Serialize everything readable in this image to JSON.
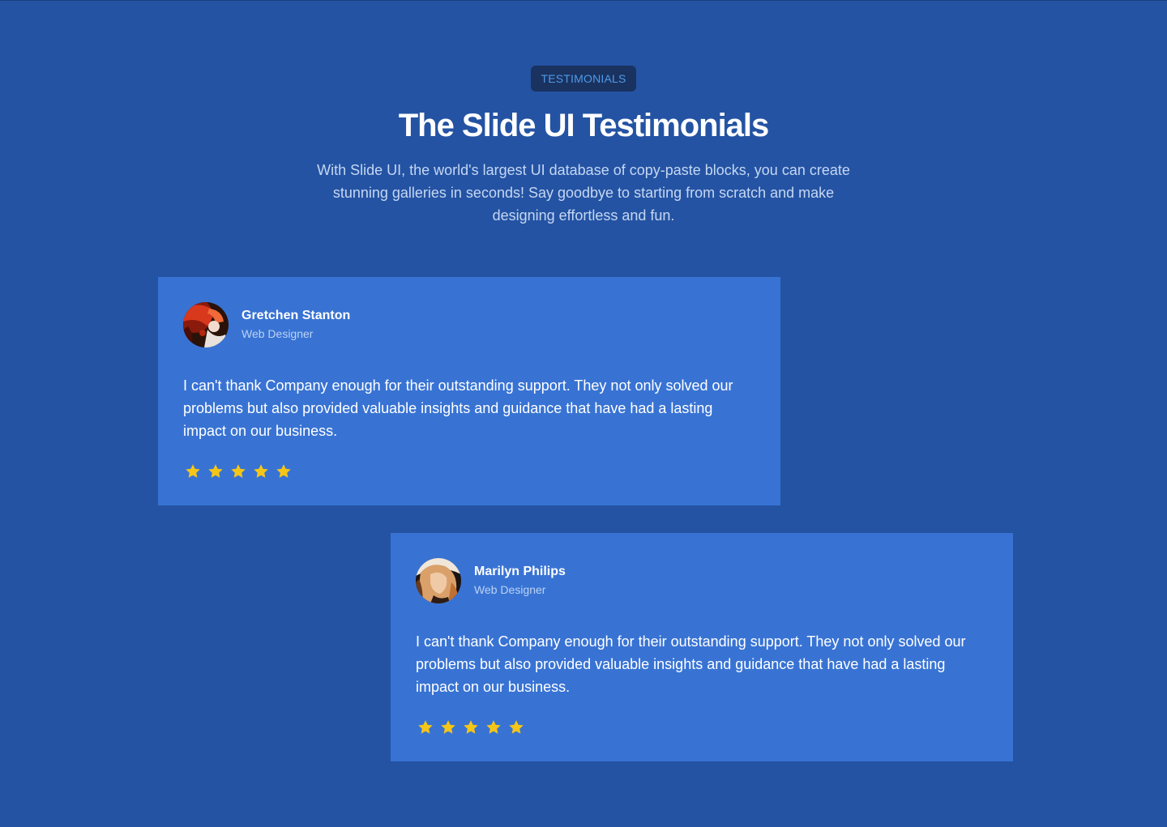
{
  "section": {
    "badge": "TESTIMONIALS",
    "title": "The Slide UI Testimonials",
    "subtitle": "With Slide UI, the world's largest UI database of copy-paste blocks, you can create stunning galleries in seconds! Say goodbye to starting from scratch and make designing effortless and fun."
  },
  "testimonials": [
    {
      "name": "Gretchen Stanton",
      "role": "Web Designer",
      "quote": "I can't thank Company enough for their outstanding support. They not only solved our problems but also provided valuable insights and guidance that have had a lasting impact on our business.",
      "rating": 5,
      "avatar_icon": "avatar-photo"
    },
    {
      "name": "Marilyn Philips",
      "role": "Web Designer",
      "quote": "I can't thank Company enough for their outstanding support. They not only solved our problems but also provided valuable insights and guidance that have had a lasting impact on our business.",
      "rating": 5,
      "avatar_icon": "avatar-photo"
    }
  ],
  "colors": {
    "background": "#2453a3",
    "card": "#3873d4",
    "badge_bg": "#1a3260",
    "badge_text": "#4f9ae8",
    "star": "#f5c518"
  }
}
